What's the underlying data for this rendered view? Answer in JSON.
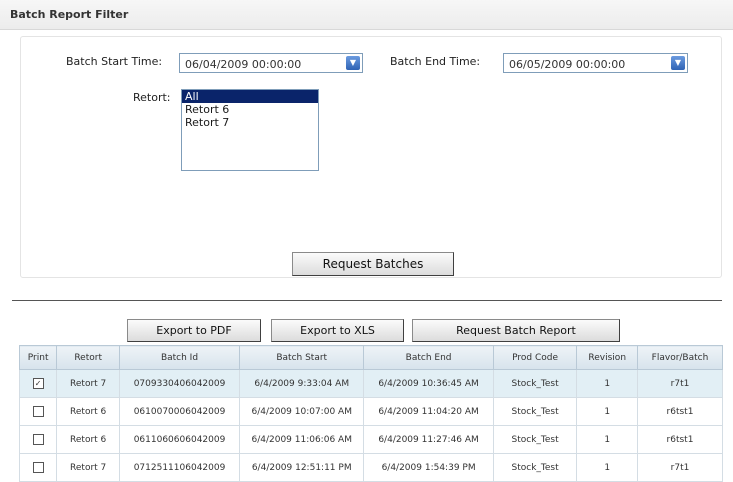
{
  "panel": {
    "title": "Batch Report Filter"
  },
  "filter": {
    "start_label": "Batch Start Time:",
    "start_value": "06/04/2009 00:00:00",
    "end_label": "Batch End Time:",
    "end_value": "06/05/2009 00:00:00",
    "retort_label": "Retort:",
    "retort_options": [
      "All",
      "Retort 6",
      "Retort 7"
    ],
    "retort_selected": "All",
    "request_batches": "Request Batches"
  },
  "actions": {
    "export_pdf": "Export to PDF",
    "export_xls": "Export to XLS",
    "request_report": "Request Batch Report"
  },
  "table": {
    "headers": [
      "Print",
      "Retort",
      "Batch Id",
      "Batch Start",
      "Batch End",
      "Prod Code",
      "Revision",
      "Flavor/Batch"
    ],
    "rows": [
      {
        "checked": true,
        "cells": [
          "Retort 7",
          "0709330406042009",
          "6/4/2009 9:33:04 AM",
          "6/4/2009 10:36:45 AM",
          "Stock_Test",
          "1",
          "r7t1"
        ]
      },
      {
        "checked": false,
        "cells": [
          "Retort 6",
          "0610070006042009",
          "6/4/2009 10:07:00 AM",
          "6/4/2009 11:04:20 AM",
          "Stock_Test",
          "1",
          "r6tst1"
        ]
      },
      {
        "checked": false,
        "cells": [
          "Retort 6",
          "0611060606042009",
          "6/4/2009 11:06:06 AM",
          "6/4/2009 11:27:46 AM",
          "Stock_Test",
          "1",
          "r6tst1"
        ]
      },
      {
        "checked": false,
        "cells": [
          "Retort 7",
          "0712511106042009",
          "6/4/2009 12:51:11 PM",
          "6/4/2009 1:54:39 PM",
          "Stock_Test",
          "1",
          "r7t1"
        ]
      }
    ]
  },
  "colors": {
    "selection": "#0a246a",
    "row_highlight": "#e2eff5",
    "header_bg": "#d7e3ec"
  },
  "icons": {
    "dropdown": "calendar-dropdown-icon",
    "check": "checkbox-icon"
  }
}
